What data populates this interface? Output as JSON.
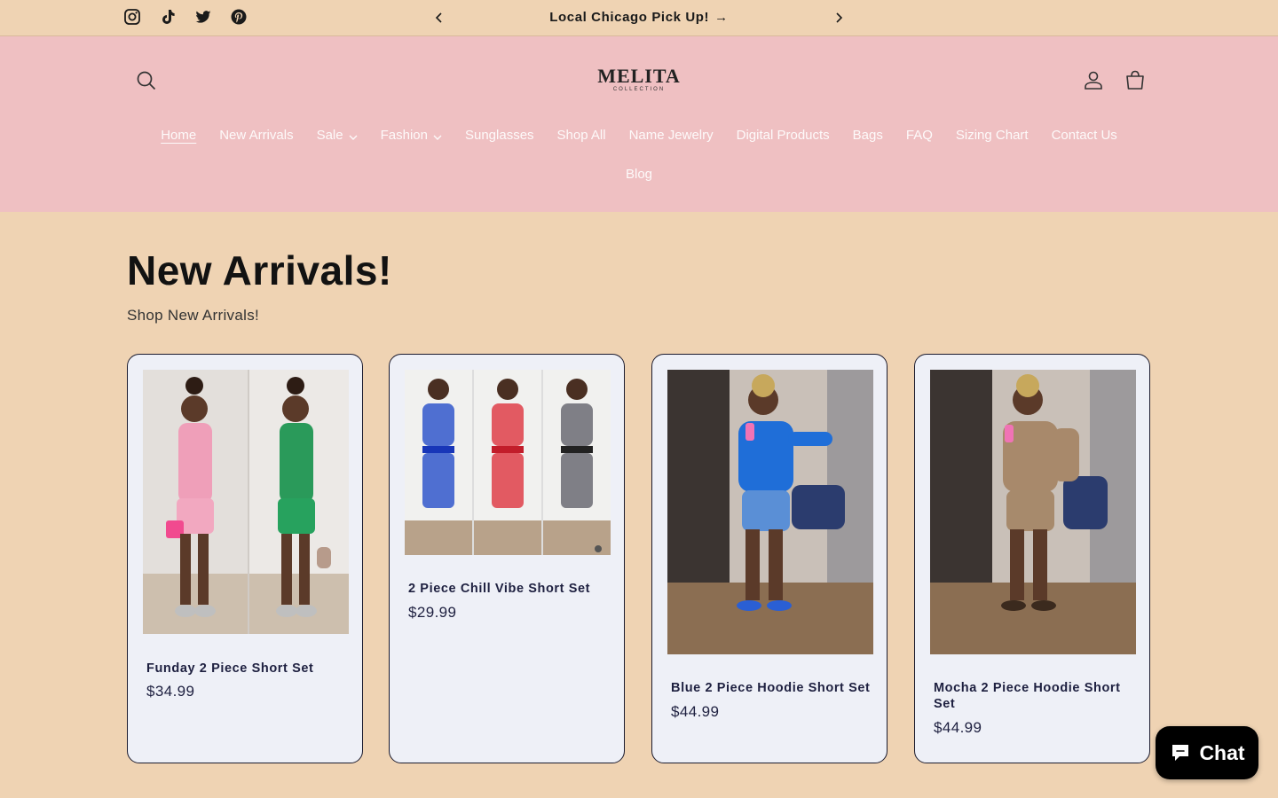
{
  "announcement": {
    "text": "Local Chicago Pick Up!",
    "arrow": "→"
  },
  "social_icons": [
    "instagram-icon",
    "tiktok-icon",
    "twitter-icon",
    "pinterest-icon"
  ],
  "header": {
    "logo_text": "MELITA",
    "logo_sub": "COLLECTION"
  },
  "nav": {
    "items": [
      {
        "label": "Home"
      },
      {
        "label": "New Arrivals"
      },
      {
        "label": "Sale"
      },
      {
        "label": "Fashion"
      },
      {
        "label": "Sunglasses"
      },
      {
        "label": "Shop All"
      },
      {
        "label": "Name Jewelry"
      },
      {
        "label": "Digital Products"
      },
      {
        "label": "Bags"
      },
      {
        "label": "FAQ"
      },
      {
        "label": "Sizing Chart"
      },
      {
        "label": "Contact Us"
      },
      {
        "label": "Blog"
      }
    ]
  },
  "main": {
    "title": "New Arrivals!",
    "subtitle": "Shop New Arrivals!"
  },
  "products": [
    {
      "name": "Funday 2 Piece Short Set",
      "price": "$34.99"
    },
    {
      "name": "2 Piece Chill Vibe Short Set",
      "price": "$29.99"
    },
    {
      "name": "Blue 2 Piece Hoodie Short Set",
      "price": "$44.99"
    },
    {
      "name": "Mocha 2 Piece Hoodie Short Set",
      "price": "$44.99"
    }
  ],
  "chat": {
    "label": "Chat"
  },
  "colors": {
    "page_bg": "#efd3b3",
    "header_bg": "#efc0c2",
    "card_bg": "#eef0f7",
    "chat_bg": "#000000"
  }
}
